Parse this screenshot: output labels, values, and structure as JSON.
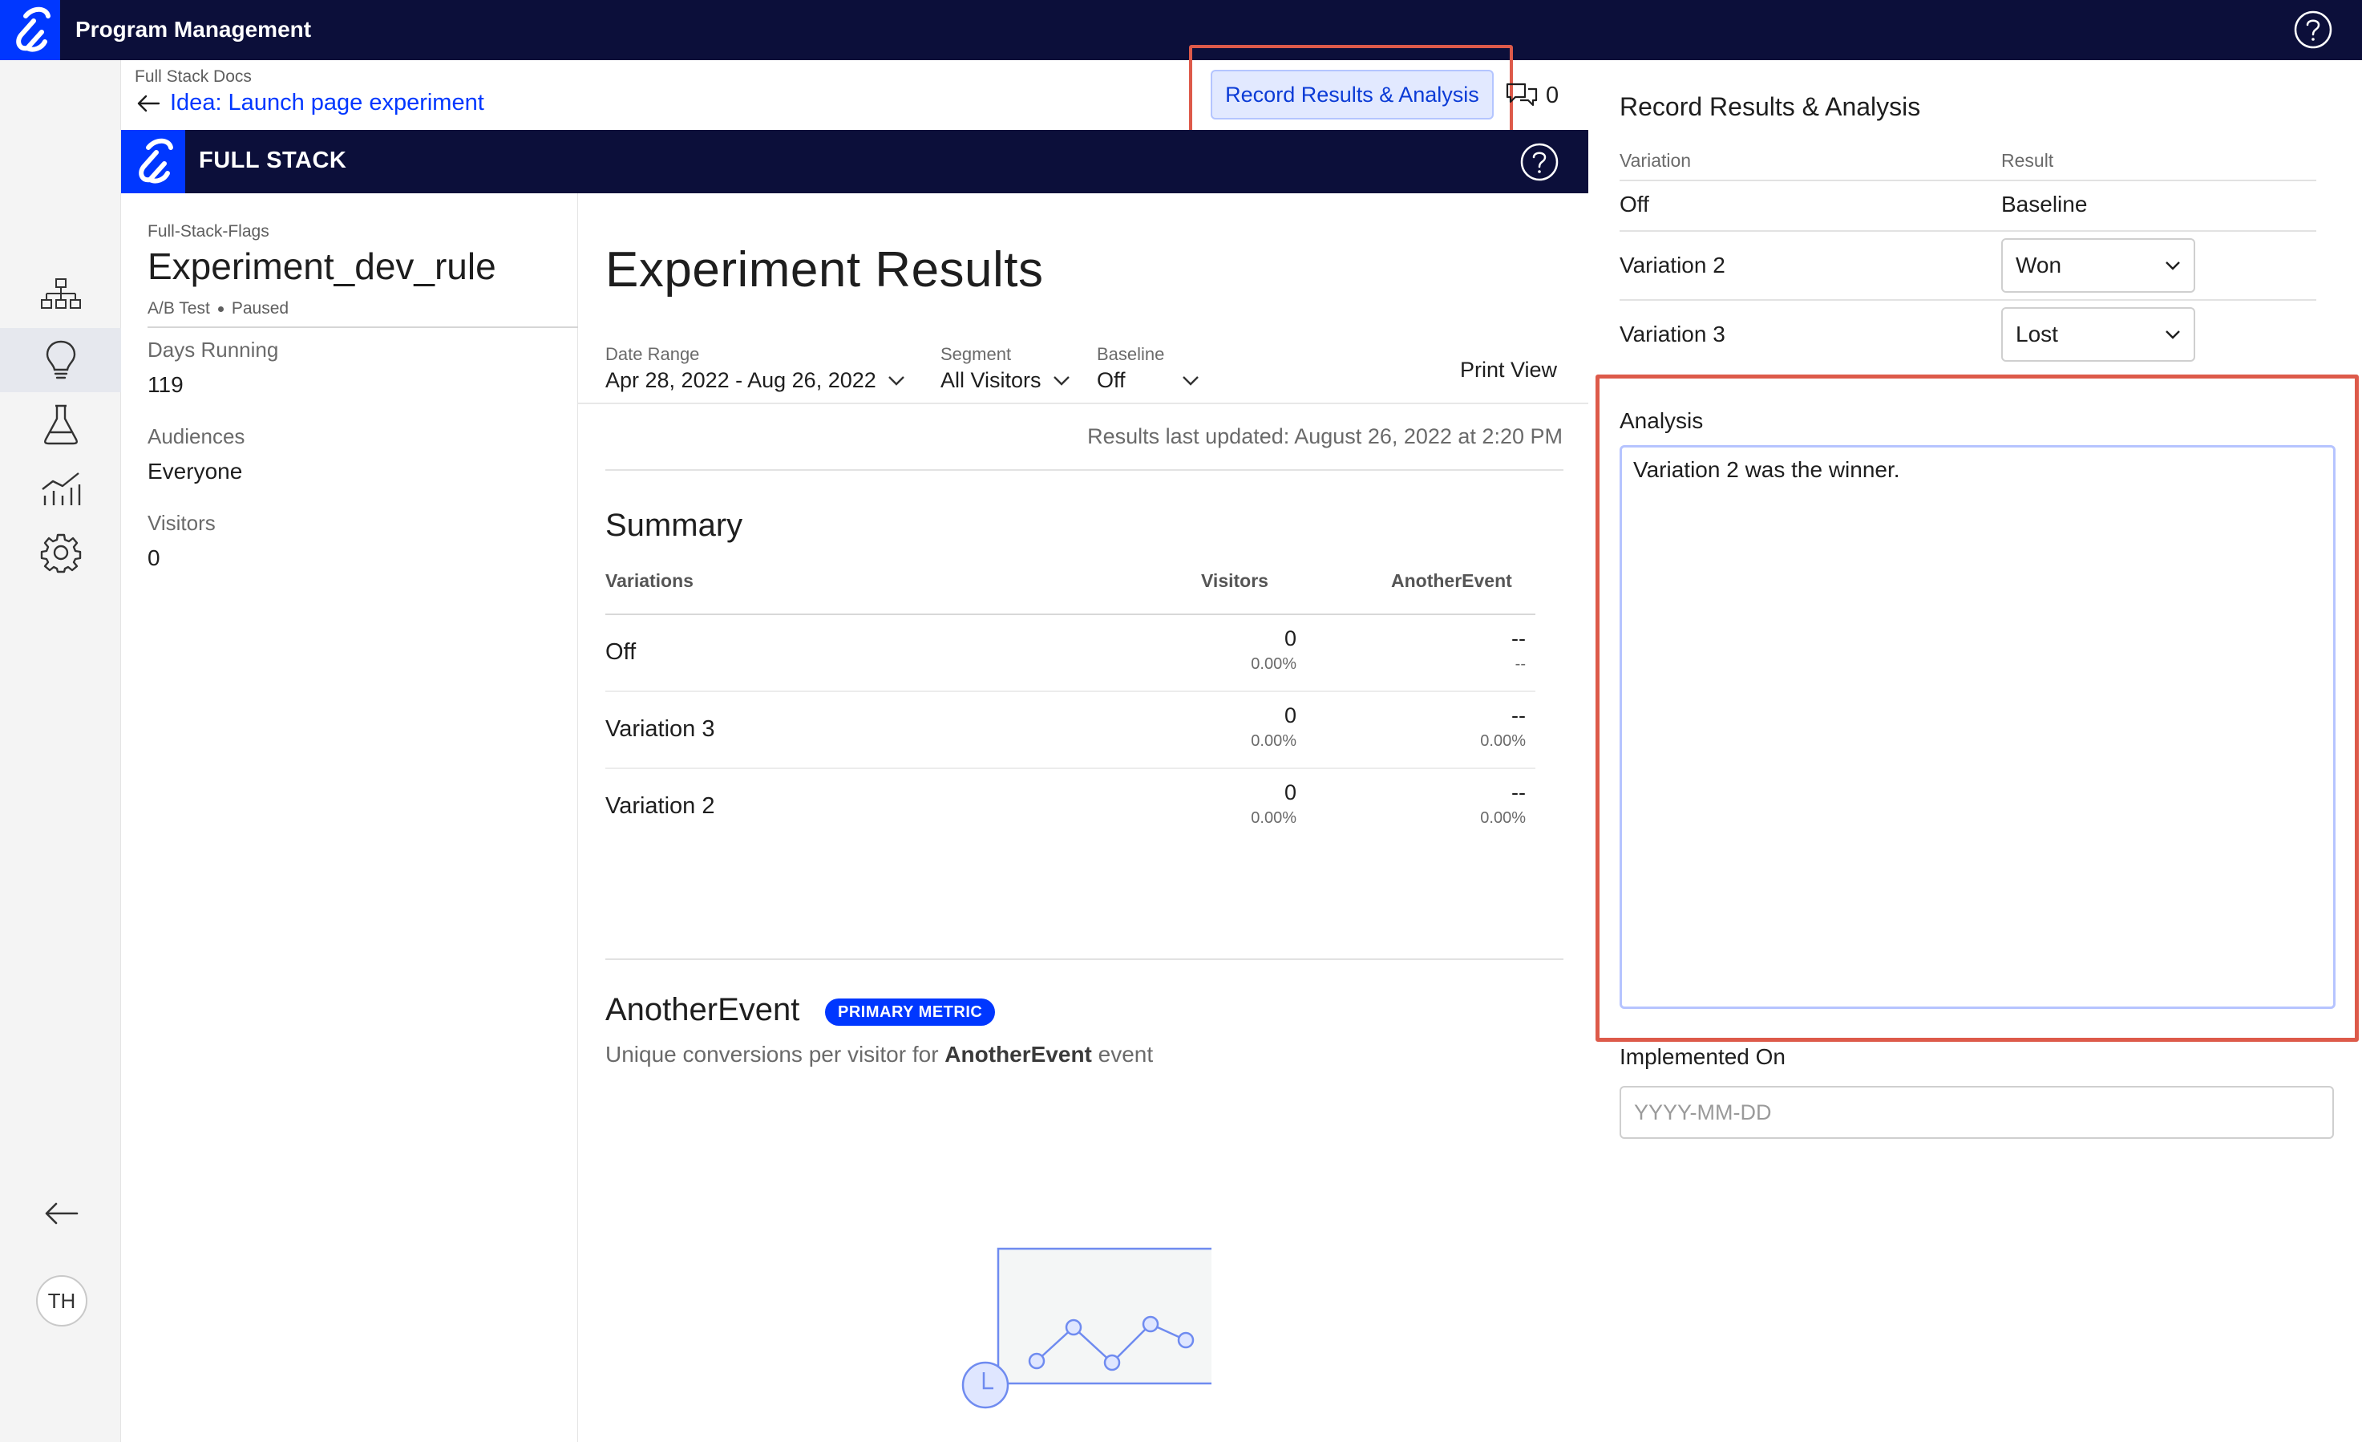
{
  "app": {
    "title": "Program Management"
  },
  "header": {
    "breadcrumb_parent": "Full Stack Docs",
    "breadcrumb_link": "Idea: Launch page experiment",
    "record_button": "Record Results & Analysis",
    "comment_count": "0"
  },
  "banner": {
    "title": "FULL STACK"
  },
  "info": {
    "project": "Full-Stack-Flags",
    "rule_name": "Experiment_dev_rule",
    "type": "A/B Test",
    "status": "Paused",
    "days_running_label": "Days Running",
    "days_running_value": "119",
    "audiences_label": "Audiences",
    "audiences_value": "Everyone",
    "visitors_label": "Visitors",
    "visitors_value": "0"
  },
  "main": {
    "title": "Experiment Results",
    "date_range_label": "Date Range",
    "date_range_value": "Apr 28, 2022 - Aug 26, 2022",
    "segment_label": "Segment",
    "segment_value": "All Visitors",
    "baseline_label": "Baseline",
    "baseline_value": "Off",
    "print_view": "Print View",
    "last_updated": "Results last updated: August 26, 2022 at 2:20 PM",
    "summary_title": "Summary",
    "summary_headers": [
      "Variations",
      "Visitors",
      "AnotherEvent"
    ],
    "summary_rows": [
      {
        "name": "Off",
        "visitors": "0",
        "visitors_pct": "0.00%",
        "event": "--",
        "event_sub": "--"
      },
      {
        "name": "Variation 3",
        "visitors": "0",
        "visitors_pct": "0.00%",
        "event": "--",
        "event_sub": "0.00%"
      },
      {
        "name": "Variation 2",
        "visitors": "0",
        "visitors_pct": "0.00%",
        "event": "--",
        "event_sub": "0.00%"
      }
    ],
    "metric_title": "AnotherEvent",
    "metric_badge": "PRIMARY METRIC",
    "metric_desc_prefix": "Unique conversions per visitor for ",
    "metric_desc_event": "AnotherEvent",
    "metric_desc_suffix": " event"
  },
  "panel": {
    "title": "Record Results & Analysis",
    "col_variation": "Variation",
    "col_result": "Result",
    "rows": [
      {
        "name": "Off",
        "result": "Baseline"
      },
      {
        "name": "Variation 2",
        "result": "Won"
      },
      {
        "name": "Variation 3",
        "result": "Lost"
      }
    ],
    "analysis_label": "Analysis",
    "analysis_text": "Variation 2 was the winner.",
    "implemented_label": "Implemented On",
    "implemented_placeholder": "YYYY-MM-DD"
  },
  "rail": {
    "avatar_initials": "TH",
    "icons": [
      "hierarchy-icon",
      "lightbulb-icon",
      "flask-icon",
      "analytics-icon",
      "gear-icon",
      "collapse-arrow-icon"
    ]
  },
  "colors": {
    "navy": "#0c0f3a",
    "brand_blue": "#0037ff",
    "highlight_red": "#dd5a4a"
  }
}
